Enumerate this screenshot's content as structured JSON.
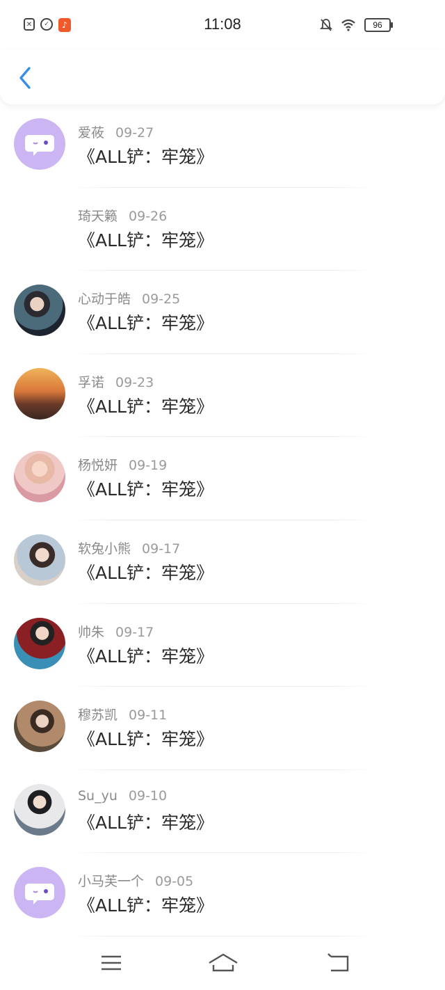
{
  "status": {
    "time": "11:08",
    "battery": "96"
  },
  "colors": {
    "accent": "#3a8ee6",
    "bubble_avatar_bg": "#cbb5f3"
  },
  "items": [
    {
      "name": "爱莜",
      "date": "09-27",
      "title": "《ALL铲：牢笼》",
      "avatar": "bubble"
    },
    {
      "name": "琦天籁",
      "date": "09-26",
      "title": "《ALL铲：牢笼》",
      "avatar": "none"
    },
    {
      "name": "心动于皓",
      "date": "09-25",
      "title": "《ALL铲：牢笼》",
      "avatar": "photo"
    },
    {
      "name": "孚诺",
      "date": "09-23",
      "title": "《ALL铲：牢笼》",
      "avatar": "photo"
    },
    {
      "name": "杨悦妍",
      "date": "09-19",
      "title": "《ALL铲：牢笼》",
      "avatar": "photo"
    },
    {
      "name": "软兔小熊",
      "date": "09-17",
      "title": "《ALL铲：牢笼》",
      "avatar": "photo"
    },
    {
      "name": "帅朱",
      "date": "09-17",
      "title": "《ALL铲：牢笼》",
      "avatar": "photo"
    },
    {
      "name": "穆苏凯",
      "date": "09-11",
      "title": "《ALL铲：牢笼》",
      "avatar": "photo"
    },
    {
      "name": "Su_yu",
      "date": "09-10",
      "title": "《ALL铲：牢笼》",
      "avatar": "photo"
    },
    {
      "name": "小马芙一个",
      "date": "09-05",
      "title": "《ALL铲：牢笼》",
      "avatar": "bubble"
    }
  ],
  "icons": {
    "back": "chevron-left-icon",
    "nav": [
      "menu-icon",
      "home-icon",
      "return-icon"
    ]
  }
}
